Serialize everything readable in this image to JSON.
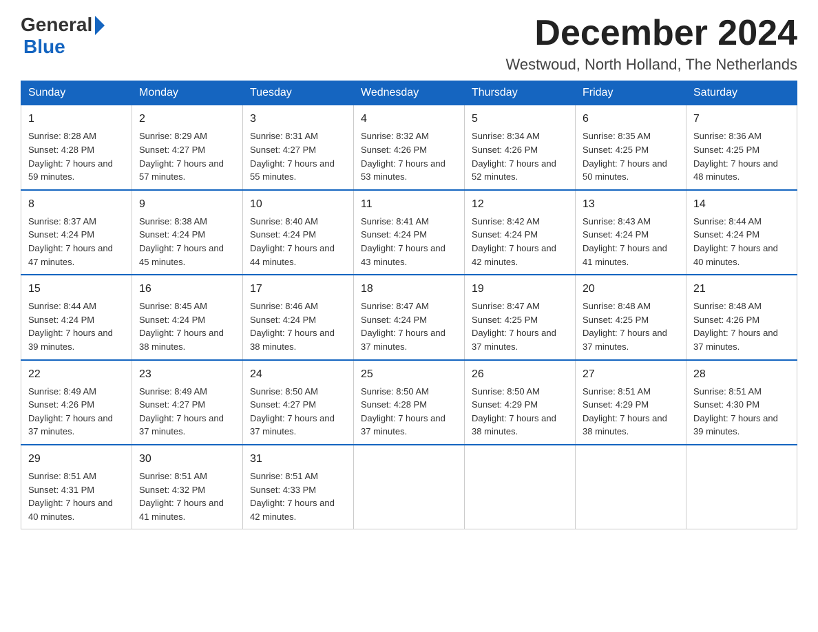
{
  "header": {
    "logo_general": "General",
    "logo_blue": "Blue",
    "month_title": "December 2024",
    "location": "Westwoud, North Holland, The Netherlands"
  },
  "weekdays": [
    "Sunday",
    "Monday",
    "Tuesday",
    "Wednesday",
    "Thursday",
    "Friday",
    "Saturday"
  ],
  "weeks": [
    [
      {
        "day": "1",
        "sunrise": "8:28 AM",
        "sunset": "4:28 PM",
        "daylight": "7 hours and 59 minutes."
      },
      {
        "day": "2",
        "sunrise": "8:29 AM",
        "sunset": "4:27 PM",
        "daylight": "7 hours and 57 minutes."
      },
      {
        "day": "3",
        "sunrise": "8:31 AM",
        "sunset": "4:27 PM",
        "daylight": "7 hours and 55 minutes."
      },
      {
        "day": "4",
        "sunrise": "8:32 AM",
        "sunset": "4:26 PM",
        "daylight": "7 hours and 53 minutes."
      },
      {
        "day": "5",
        "sunrise": "8:34 AM",
        "sunset": "4:26 PM",
        "daylight": "7 hours and 52 minutes."
      },
      {
        "day": "6",
        "sunrise": "8:35 AM",
        "sunset": "4:25 PM",
        "daylight": "7 hours and 50 minutes."
      },
      {
        "day": "7",
        "sunrise": "8:36 AM",
        "sunset": "4:25 PM",
        "daylight": "7 hours and 48 minutes."
      }
    ],
    [
      {
        "day": "8",
        "sunrise": "8:37 AM",
        "sunset": "4:24 PM",
        "daylight": "7 hours and 47 minutes."
      },
      {
        "day": "9",
        "sunrise": "8:38 AM",
        "sunset": "4:24 PM",
        "daylight": "7 hours and 45 minutes."
      },
      {
        "day": "10",
        "sunrise": "8:40 AM",
        "sunset": "4:24 PM",
        "daylight": "7 hours and 44 minutes."
      },
      {
        "day": "11",
        "sunrise": "8:41 AM",
        "sunset": "4:24 PM",
        "daylight": "7 hours and 43 minutes."
      },
      {
        "day": "12",
        "sunrise": "8:42 AM",
        "sunset": "4:24 PM",
        "daylight": "7 hours and 42 minutes."
      },
      {
        "day": "13",
        "sunrise": "8:43 AM",
        "sunset": "4:24 PM",
        "daylight": "7 hours and 41 minutes."
      },
      {
        "day": "14",
        "sunrise": "8:44 AM",
        "sunset": "4:24 PM",
        "daylight": "7 hours and 40 minutes."
      }
    ],
    [
      {
        "day": "15",
        "sunrise": "8:44 AM",
        "sunset": "4:24 PM",
        "daylight": "7 hours and 39 minutes."
      },
      {
        "day": "16",
        "sunrise": "8:45 AM",
        "sunset": "4:24 PM",
        "daylight": "7 hours and 38 minutes."
      },
      {
        "day": "17",
        "sunrise": "8:46 AM",
        "sunset": "4:24 PM",
        "daylight": "7 hours and 38 minutes."
      },
      {
        "day": "18",
        "sunrise": "8:47 AM",
        "sunset": "4:24 PM",
        "daylight": "7 hours and 37 minutes."
      },
      {
        "day": "19",
        "sunrise": "8:47 AM",
        "sunset": "4:25 PM",
        "daylight": "7 hours and 37 minutes."
      },
      {
        "day": "20",
        "sunrise": "8:48 AM",
        "sunset": "4:25 PM",
        "daylight": "7 hours and 37 minutes."
      },
      {
        "day": "21",
        "sunrise": "8:48 AM",
        "sunset": "4:26 PM",
        "daylight": "7 hours and 37 minutes."
      }
    ],
    [
      {
        "day": "22",
        "sunrise": "8:49 AM",
        "sunset": "4:26 PM",
        "daylight": "7 hours and 37 minutes."
      },
      {
        "day": "23",
        "sunrise": "8:49 AM",
        "sunset": "4:27 PM",
        "daylight": "7 hours and 37 minutes."
      },
      {
        "day": "24",
        "sunrise": "8:50 AM",
        "sunset": "4:27 PM",
        "daylight": "7 hours and 37 minutes."
      },
      {
        "day": "25",
        "sunrise": "8:50 AM",
        "sunset": "4:28 PM",
        "daylight": "7 hours and 37 minutes."
      },
      {
        "day": "26",
        "sunrise": "8:50 AM",
        "sunset": "4:29 PM",
        "daylight": "7 hours and 38 minutes."
      },
      {
        "day": "27",
        "sunrise": "8:51 AM",
        "sunset": "4:29 PM",
        "daylight": "7 hours and 38 minutes."
      },
      {
        "day": "28",
        "sunrise": "8:51 AM",
        "sunset": "4:30 PM",
        "daylight": "7 hours and 39 minutes."
      }
    ],
    [
      {
        "day": "29",
        "sunrise": "8:51 AM",
        "sunset": "4:31 PM",
        "daylight": "7 hours and 40 minutes."
      },
      {
        "day": "30",
        "sunrise": "8:51 AM",
        "sunset": "4:32 PM",
        "daylight": "7 hours and 41 minutes."
      },
      {
        "day": "31",
        "sunrise": "8:51 AM",
        "sunset": "4:33 PM",
        "daylight": "7 hours and 42 minutes."
      },
      null,
      null,
      null,
      null
    ]
  ]
}
